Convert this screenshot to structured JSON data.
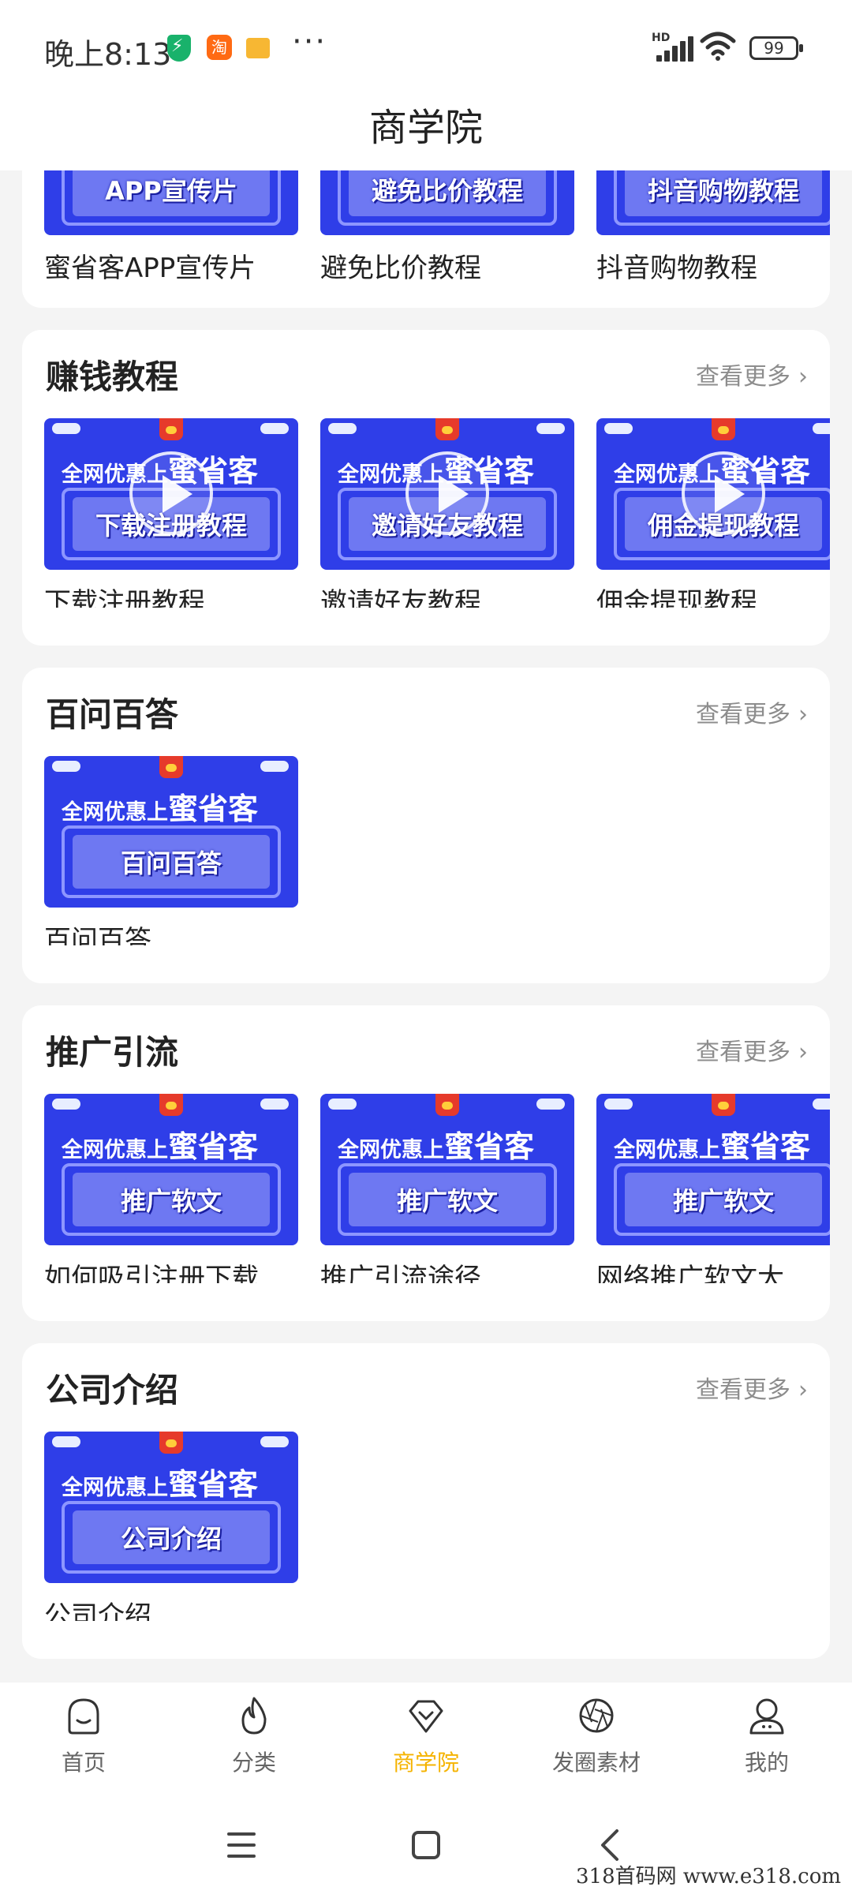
{
  "status_bar": {
    "time": "晚上8:13",
    "network": "HD",
    "battery": "99",
    "icons": [
      "security-shield-icon",
      "taobao-app-icon",
      "message-icon",
      "more-dots-icon",
      "signal-icon",
      "wifi-icon",
      "battery-icon"
    ]
  },
  "header": {
    "title": "商学院"
  },
  "top_partial": {
    "items": [
      {
        "thumb_text": "APP宣传片",
        "label": "蜜省客APP宣传片"
      },
      {
        "thumb_text": "避免比价教程",
        "label": "避免比价教程"
      },
      {
        "thumb_text": "抖音购物教程",
        "label": "抖音购物教程"
      }
    ]
  },
  "banner": {
    "prefix": "全网优惠上",
    "brand": "蜜省客"
  },
  "more_label": "查看更多",
  "sections": [
    {
      "title": "赚钱教程",
      "items": [
        {
          "thumb_text": "下载注册教程",
          "label": "下载注册教程",
          "video": true
        },
        {
          "thumb_text": "邀请好友教程",
          "label": "邀请好友教程",
          "video": true
        },
        {
          "thumb_text": "佣金提现教程",
          "label": "佣金提现教程",
          "video": true
        }
      ]
    },
    {
      "title": "百问百答",
      "items": [
        {
          "thumb_text": "百问百答",
          "label": "百问百答",
          "video": false
        }
      ]
    },
    {
      "title": "推广引流",
      "items": [
        {
          "thumb_text": "推广软文",
          "label": "如何吸引注册下载",
          "video": false
        },
        {
          "thumb_text": "推广软文",
          "label": "推广引流途径",
          "video": false
        },
        {
          "thumb_text": "推广软文",
          "label": "网络推广软文大.",
          "video": false
        }
      ]
    },
    {
      "title": "公司介绍",
      "items": [
        {
          "thumb_text": "公司介绍",
          "label": "公司介绍",
          "video": false
        }
      ]
    }
  ],
  "tabbar": {
    "tabs": [
      {
        "label": "首页",
        "icon": "home-icon",
        "active": false
      },
      {
        "label": "分类",
        "icon": "flame-icon",
        "active": false
      },
      {
        "label": "商学院",
        "icon": "diamond-icon",
        "active": true
      },
      {
        "label": "发圈素材",
        "icon": "aperture-icon",
        "active": false
      },
      {
        "label": "我的",
        "icon": "profile-icon",
        "active": false
      }
    ]
  },
  "system_nav": {
    "icons": [
      "menu-icon",
      "home-square-icon",
      "back-icon"
    ]
  },
  "watermark": "318首码网  www.e318.com",
  "colors": {
    "accent": "#f5b300",
    "thumb_blue": "#2f3ee8",
    "page_bg": "#f4f4f4"
  }
}
